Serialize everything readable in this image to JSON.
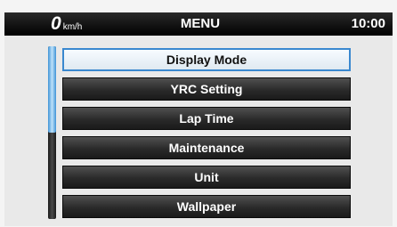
{
  "status_bar": {
    "speed_value": "0",
    "speed_unit": "km/h",
    "title": "MENU",
    "time": "10:00"
  },
  "menu": {
    "items": [
      {
        "label": "Display Mode",
        "selected": true
      },
      {
        "label": "YRC Setting",
        "selected": false
      },
      {
        "label": "Lap Time",
        "selected": false
      },
      {
        "label": "Maintenance",
        "selected": false
      },
      {
        "label": "Unit",
        "selected": false
      },
      {
        "label": "Wallpaper",
        "selected": false
      }
    ],
    "scroll_fraction_visible": 0.5
  },
  "colors": {
    "selection_border": "#3a88cf",
    "scroll_thumb": "#7fbde9",
    "status_bar_bg": "#000000"
  }
}
